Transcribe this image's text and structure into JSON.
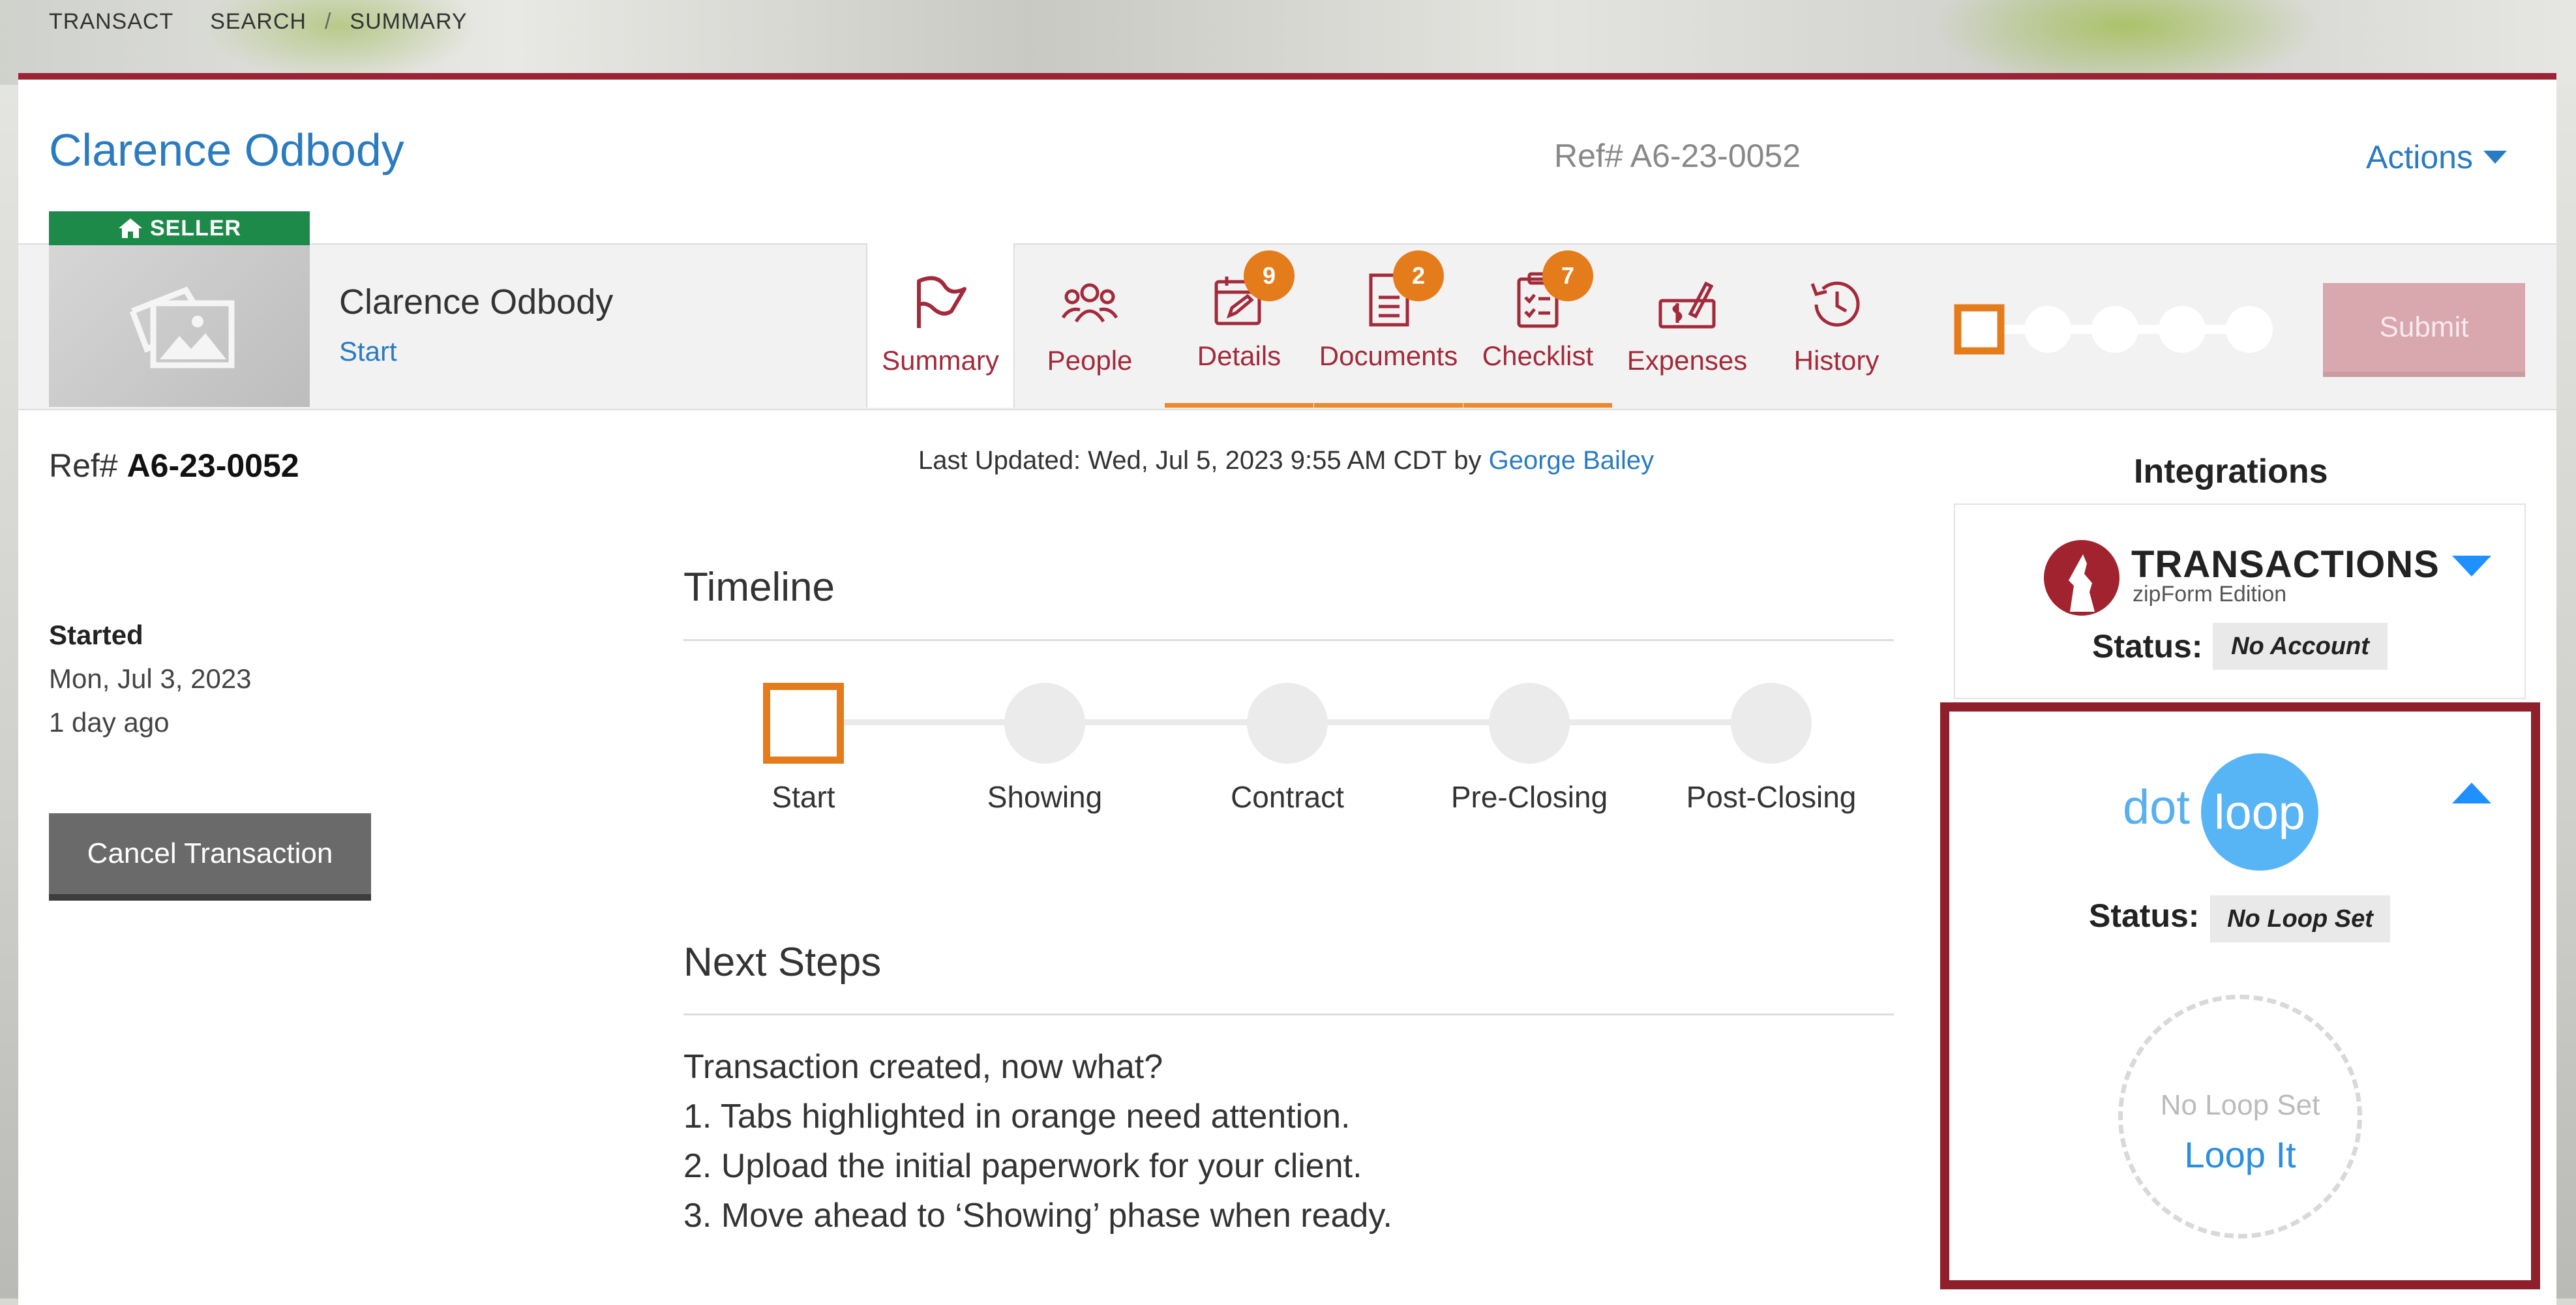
{
  "breadcrumb": [
    "TRANSACT",
    "SEARCH",
    "SUMMARY"
  ],
  "breadcrumb_sep": "/",
  "header": {
    "client_name": "Clarence Odbody",
    "ref": "Ref# A6-23-0052",
    "actions_label": "Actions"
  },
  "role_badge": "SELLER",
  "tabbar": {
    "client_name": "Clarence Odbody",
    "status": "Start",
    "tabs": [
      {
        "label": "Summary",
        "icon": "flag-icon"
      },
      {
        "label": "People",
        "icon": "people-icon"
      },
      {
        "label": "Details",
        "icon": "calendar-edit-icon",
        "badge": "9"
      },
      {
        "label": "Documents",
        "icon": "document-icon",
        "badge": "2"
      },
      {
        "label": "Checklist",
        "icon": "clipboard-check-icon",
        "badge": "7"
      },
      {
        "label": "Expenses",
        "icon": "money-pen-icon"
      },
      {
        "label": "History",
        "icon": "history-icon"
      }
    ],
    "submit_label": "Submit"
  },
  "colors": {
    "brand_red": "#9b2335",
    "accent_orange": "#e57c1b",
    "link_blue": "#2b7bc0",
    "seller_green": "#1e8a4a"
  },
  "summary": {
    "ref_prefix": "Ref#",
    "ref_value": "A6-23-0052",
    "last_updated_text": "Last Updated: Wed, Jul 5, 2023 9:55 AM CDT by",
    "last_updated_user": "George Bailey",
    "started_label": "Started",
    "started_date": "Mon, Jul 3, 2023",
    "started_ago": "1 day ago",
    "cancel_label": "Cancel Transaction"
  },
  "timeline": {
    "title": "Timeline",
    "stages": [
      "Start",
      "Showing",
      "Contract",
      "Pre-Closing",
      "Post-Closing"
    ],
    "current_index": 0
  },
  "next_steps": {
    "title": "Next Steps",
    "lines": [
      "Transaction created, now what?",
      "1. Tabs highlighted in orange need attention.",
      "2. Upload the initial paperwork for your client.",
      "3. Move ahead to ‘Showing’ phase when ready."
    ]
  },
  "integrations": {
    "title": "Integrations",
    "zipform": {
      "name": "TRANSACTIONS",
      "sub": "zipForm Edition",
      "status_label": "Status:",
      "status_value": "No Account"
    },
    "dotloop": {
      "logo_dot": "dot",
      "logo_loop": "loop",
      "status_label": "Status:",
      "status_value": "No Loop Set",
      "circle_text": "No Loop Set",
      "action_label": "Loop It"
    }
  }
}
